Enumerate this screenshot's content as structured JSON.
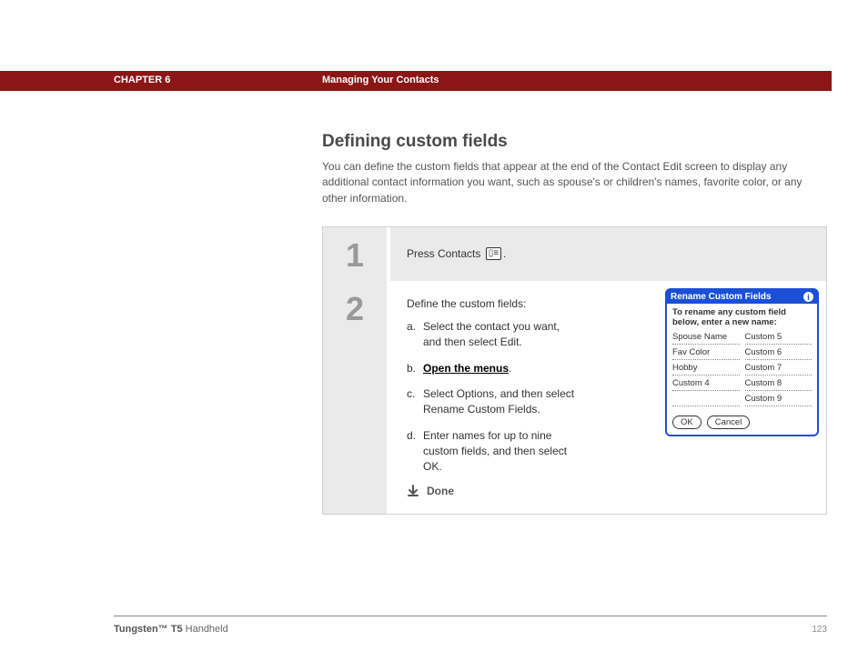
{
  "header": {
    "chapter": "CHAPTER 6",
    "title": "Managing Your Contacts"
  },
  "section": {
    "title": "Defining custom fields",
    "description": "You can define the custom fields that appear at the end of the Contact Edit screen to display any additional contact information you want, such as spouse's or children's names, favorite color, or any other information."
  },
  "steps": {
    "one": {
      "num": "1",
      "text_pre": "Press Contacts ",
      "text_post": "."
    },
    "two": {
      "num": "2",
      "intro": "Define the custom fields:",
      "a": "Select the contact you want, and then select Edit.",
      "b_link": "Open the menus",
      "b_post": ".",
      "c": "Select Options, and then select Rename Custom Fields.",
      "d": "Enter names for up to nine custom fields, and then select OK.",
      "done": "Done",
      "markers": {
        "a": "a.",
        "b": "b.",
        "c": "c.",
        "d": "d."
      }
    }
  },
  "dialog": {
    "title": "Rename Custom Fields",
    "instruction": "To rename any custom field below, enter a new name:",
    "col1": [
      "Spouse Name",
      "Fav Color",
      "Hobby",
      "Custom 4",
      ""
    ],
    "col2": [
      "Custom 5",
      "Custom 6",
      "Custom 7",
      "Custom 8",
      "Custom 9"
    ],
    "ok": "OK",
    "cancel": "Cancel"
  },
  "footer": {
    "product_bold": "Tungsten™ T5",
    "product_rest": " Handheld",
    "page": "123"
  }
}
